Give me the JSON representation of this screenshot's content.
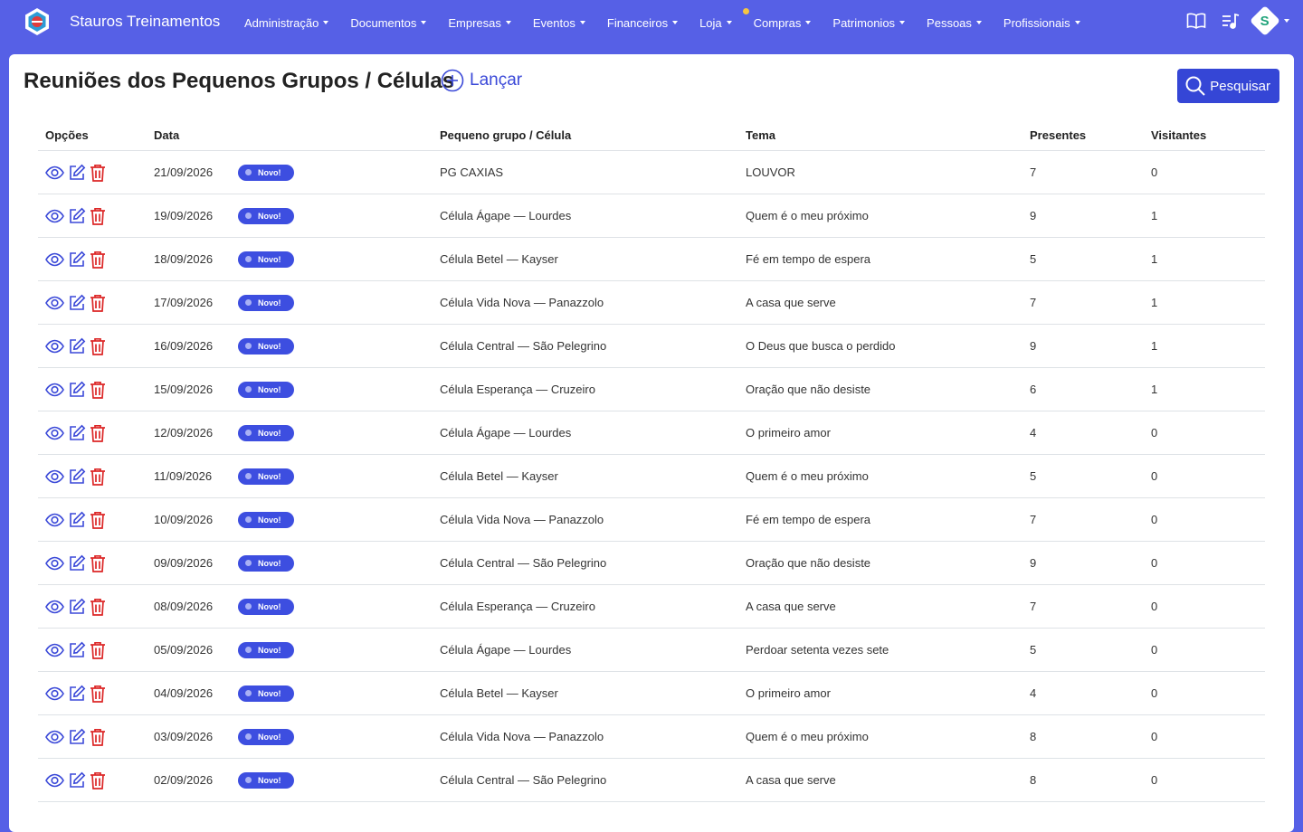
{
  "brand": {
    "name": "Stauros Treinamentos"
  },
  "nav": [
    {
      "label": "Administração"
    },
    {
      "label": "Documentos"
    },
    {
      "label": "Empresas"
    },
    {
      "label": "Eventos"
    },
    {
      "label": "Financeiros"
    },
    {
      "label": "Loja"
    },
    {
      "label": "Compras"
    },
    {
      "label": "Patrimonios"
    },
    {
      "label": "Pessoas"
    },
    {
      "label": "Profissionais"
    }
  ],
  "user": {
    "initial": "S"
  },
  "page": {
    "title": "Reuniões dos Pequenos Grupos / Células",
    "launch_label": "Lançar",
    "search_label": "Pesquisar"
  },
  "table": {
    "headers": {
      "options": "Opções",
      "date": "Data",
      "group": "Pequeno grupo / Célula",
      "theme": "Tema",
      "present": "Presentes",
      "visitors": "Visitantes"
    },
    "badge_label": "Novo!",
    "rows": [
      {
        "date": "21/09/2026",
        "group": "PG CAXIAS",
        "theme": "LOUVOR",
        "present": "7",
        "visitors": "0"
      },
      {
        "date": "19/09/2026",
        "group": "Célula Ágape — Lourdes",
        "theme": "Quem é o meu próximo",
        "present": "9",
        "visitors": "1"
      },
      {
        "date": "18/09/2026",
        "group": "Célula Betel — Kayser",
        "theme": "Fé em tempo de espera",
        "present": "5",
        "visitors": "1"
      },
      {
        "date": "17/09/2026",
        "group": "Célula Vida Nova — Panazzolo",
        "theme": "A casa que serve",
        "present": "7",
        "visitors": "1"
      },
      {
        "date": "16/09/2026",
        "group": "Célula Central — São Pelegrino",
        "theme": "O Deus que busca o perdido",
        "present": "9",
        "visitors": "1"
      },
      {
        "date": "15/09/2026",
        "group": "Célula Esperança — Cruzeiro",
        "theme": "Oração que não desiste",
        "present": "6",
        "visitors": "1"
      },
      {
        "date": "12/09/2026",
        "group": "Célula Ágape — Lourdes",
        "theme": "O primeiro amor",
        "present": "4",
        "visitors": "0"
      },
      {
        "date": "11/09/2026",
        "group": "Célula Betel — Kayser",
        "theme": "Quem é o meu próximo",
        "present": "5",
        "visitors": "0"
      },
      {
        "date": "10/09/2026",
        "group": "Célula Vida Nova — Panazzolo",
        "theme": "Fé em tempo de espera",
        "present": "7",
        "visitors": "0"
      },
      {
        "date": "09/09/2026",
        "group": "Célula Central — São Pelegrino",
        "theme": "Oração que não desiste",
        "present": "9",
        "visitors": "0"
      },
      {
        "date": "08/09/2026",
        "group": "Célula Esperança — Cruzeiro",
        "theme": "A casa que serve",
        "present": "7",
        "visitors": "0"
      },
      {
        "date": "05/09/2026",
        "group": "Célula Ágape — Lourdes",
        "theme": "Perdoar setenta vezes sete",
        "present": "5",
        "visitors": "0"
      },
      {
        "date": "04/09/2026",
        "group": "Célula Betel — Kayser",
        "theme": "O primeiro amor",
        "present": "4",
        "visitors": "0"
      },
      {
        "date": "03/09/2026",
        "group": "Célula Vida Nova — Panazzolo",
        "theme": "Quem é o meu próximo",
        "present": "8",
        "visitors": "0"
      },
      {
        "date": "02/09/2026",
        "group": "Célula Central — São Pelegrino",
        "theme": "A casa que serve",
        "present": "8",
        "visitors": "0"
      }
    ]
  },
  "colors": {
    "navbar": "#5660e6",
    "primary": "#3546d6",
    "badge": "#3d4ee0",
    "delete": "#dc2626",
    "view": "#3b49d8"
  },
  "icons": {
    "view": "eye-icon",
    "edit": "edit-icon",
    "delete": "trash-icon",
    "launch": "plus-circle-icon",
    "search": "search-icon",
    "book": "book-icon",
    "music": "music-list-icon"
  }
}
